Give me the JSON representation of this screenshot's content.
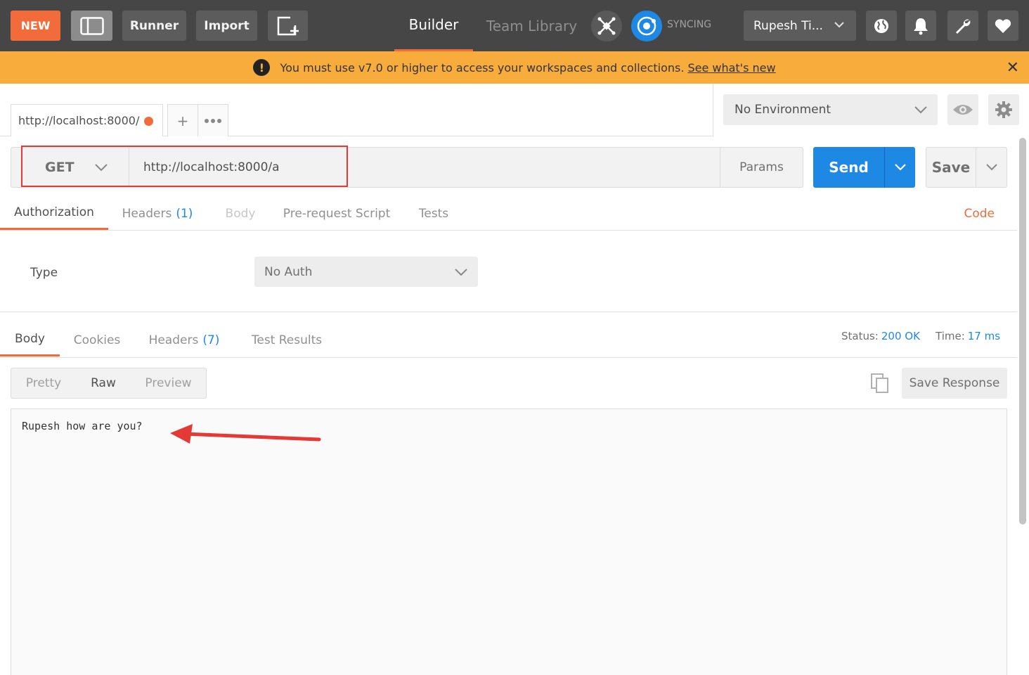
{
  "topbar": {
    "new_label": "NEW",
    "runner_label": "Runner",
    "import_label": "Import",
    "nav_builder": "Builder",
    "nav_team_library": "Team Library",
    "sync_label": "SYNCING",
    "user_label": "Rupesh Ti..."
  },
  "banner": {
    "message": "You must use v7.0 or higher to access your workspaces and collections.",
    "link": "See what's new"
  },
  "request_tab": {
    "label": "http://localhost:8000/"
  },
  "environment": {
    "selected": "No Environment"
  },
  "request": {
    "method": "GET",
    "url": "http://localhost:8000/a",
    "params_label": "Params",
    "send_label": "Send",
    "save_label": "Save"
  },
  "request_tabs": {
    "authorization": "Authorization",
    "headers": "Headers",
    "headers_count": "(1)",
    "body": "Body",
    "pre_request": "Pre-request Script",
    "tests": "Tests",
    "code": "Code"
  },
  "auth": {
    "type_label": "Type",
    "type_value": "No Auth"
  },
  "response_tabs": {
    "body": "Body",
    "cookies": "Cookies",
    "headers": "Headers",
    "headers_count": "(7)",
    "test_results": "Test Results",
    "status_label": "Status:",
    "status_value": "200 OK",
    "time_label": "Time:",
    "time_value": "17 ms"
  },
  "response_view": {
    "pretty": "Pretty",
    "raw": "Raw",
    "preview": "Preview",
    "save_response": "Save Response",
    "body_text": "Rupesh how are you?"
  },
  "colors": {
    "accent": "#f26b3a",
    "primary": "#1e88e5",
    "banner": "#f8ac3c",
    "annotation": "#e53935"
  }
}
